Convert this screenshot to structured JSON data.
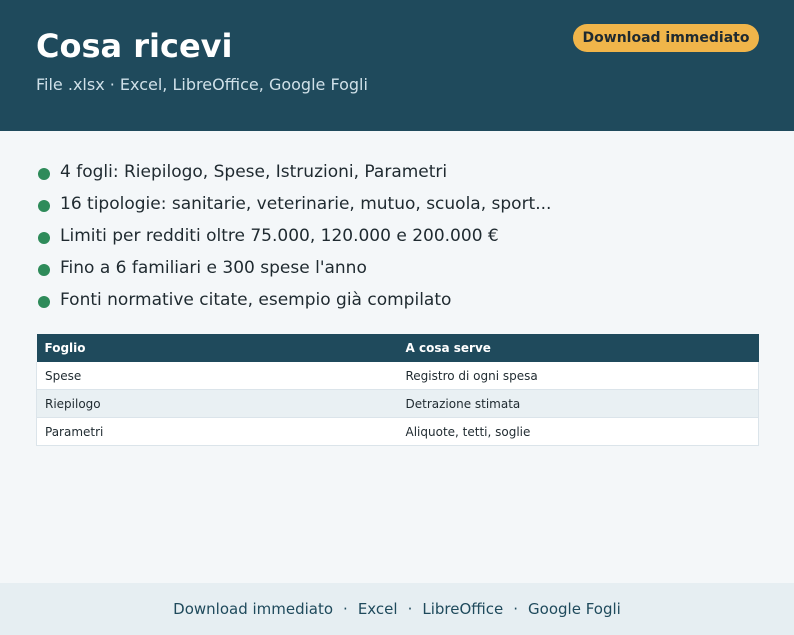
{
  "header": {
    "title": "Cosa ricevi",
    "subtitle": "File .xlsx · Excel, LibreOffice, Google Fogli",
    "cta_label": "Download immediato"
  },
  "features": [
    "4 fogli: Riepilogo, Spese, Istruzioni, Parametri",
    "16 tipologie: sanitarie, veterinarie, mutuo, scuola, sport...",
    "Limiti per redditi oltre 75.000, 120.000 e 200.000 €",
    "Fino a 6 familiari e 300 spese l'anno",
    "Fonti normative citate, esempio già compilato"
  ],
  "table": {
    "headers": [
      "Foglio",
      "A cosa serve"
    ],
    "rows": [
      [
        "Spese",
        "Registro di ogni spesa"
      ],
      [
        "Riepilogo",
        "Detrazione stimata"
      ],
      [
        "Parametri",
        "Aliquote, tetti, soglie"
      ]
    ]
  },
  "footer": {
    "links": [
      "Download immediato",
      "Excel",
      "LibreOffice",
      "Google Fogli"
    ],
    "separator": "·"
  },
  "colors": {
    "header_bg": "#1f4a5c",
    "accent": "#f0b54a",
    "bullet": "#2e8b5a",
    "page_bg": "#f4f7f9",
    "footer_bg": "#e6eef2"
  },
  "icons": {
    "bullet": "bullet-dot-icon"
  }
}
